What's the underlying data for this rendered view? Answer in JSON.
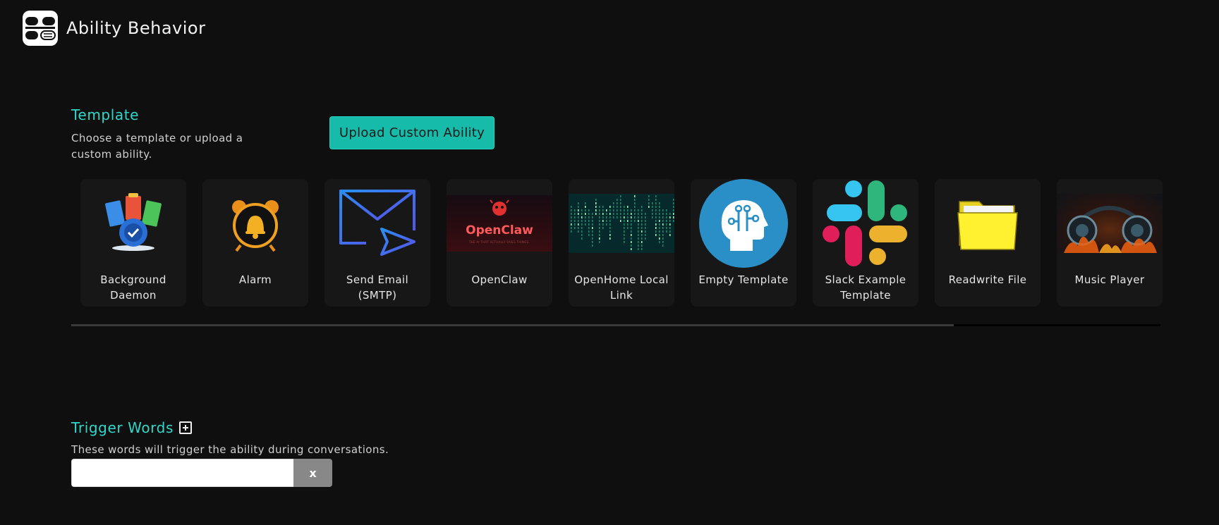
{
  "header": {
    "title": "Ability Behavior",
    "logo_icon": "openhome-logo-icon"
  },
  "template_section": {
    "title": "Template",
    "description": "Choose a template or upload a custom ability.",
    "upload_button": "Upload Custom Ability",
    "accent_color": "#2fd8c8",
    "button_color": "#16bba9"
  },
  "templates": [
    {
      "label": "Background Daemon",
      "icon": "gear-documents-icon"
    },
    {
      "label": "Alarm",
      "icon": "alarm-clock-icon"
    },
    {
      "label": "Send Email (SMTP)",
      "icon": "email-send-icon"
    },
    {
      "label": "OpenClaw",
      "icon": "openclaw-banner-icon",
      "banner_text": "OpenClaw",
      "banner_subtext": "THE AI THAT ACTUALLY DOES THINGS."
    },
    {
      "label": "OpenHome Local Link",
      "icon": "matrix-code-icon"
    },
    {
      "label": "Empty Template",
      "icon": "head-circuit-icon"
    },
    {
      "label": "Slack Example Template",
      "icon": "slack-logo-icon"
    },
    {
      "label": "Readwrite File",
      "icon": "folder-icon"
    },
    {
      "label": "Music Player",
      "icon": "headphones-fire-icon"
    }
  ],
  "carousel_scroll": {
    "visible_fraction": 0.81
  },
  "trigger_section": {
    "title": "Trigger Words",
    "add_icon": "plus-square-icon",
    "description": "These words will trigger the ability during conversations.",
    "input_value": "",
    "clear_label": "x"
  }
}
